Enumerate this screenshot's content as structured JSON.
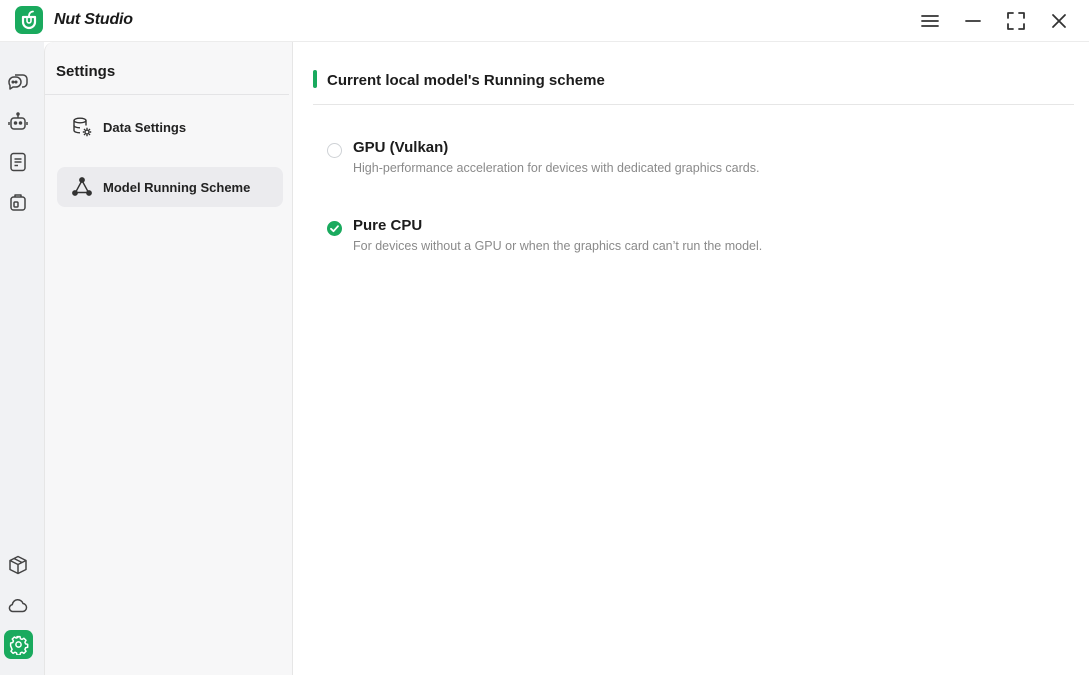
{
  "app": {
    "title": "Nut Studio",
    "brand_color": "#1aaa5e"
  },
  "window_controls": [
    "menu-icon",
    "minimize-icon",
    "maximize-icon",
    "close-icon"
  ],
  "rail": {
    "top_icons": [
      "chat-icon",
      "robot-icon",
      "document-icon",
      "briefcase-icon"
    ],
    "bottom_icons": [
      "box-icon",
      "cloud-icon",
      "settings-icon"
    ],
    "active": "settings-icon"
  },
  "settings_panel": {
    "title": "Settings",
    "items": [
      {
        "label": "Data Settings",
        "icon": "database-gear-icon",
        "active": false
      },
      {
        "label": "Model Running Scheme",
        "icon": "network-icon",
        "active": true
      }
    ]
  },
  "main": {
    "section_title": "Current local model's Running scheme",
    "options": [
      {
        "title": "GPU (Vulkan)",
        "description": "High-performance acceleration for devices with dedicated graphics cards.",
        "selected": false
      },
      {
        "title": "Pure CPU",
        "description": "For devices without a GPU or when the graphics card can’t run the model.",
        "selected": true
      }
    ]
  }
}
